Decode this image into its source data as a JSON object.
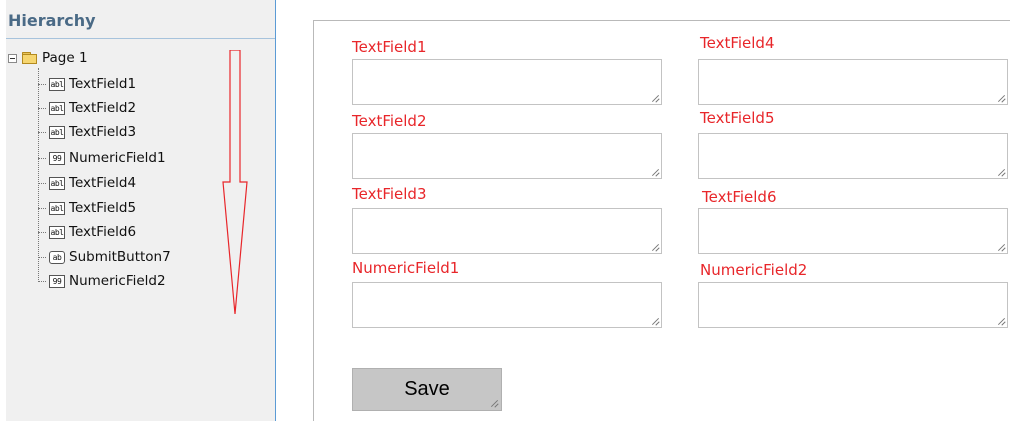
{
  "hierarchy": {
    "title": "Hierarchy",
    "root": {
      "label": "Page 1",
      "icon": "folder-icon"
    },
    "children": [
      {
        "type": "text",
        "icon_text": "abl",
        "label": "TextField1"
      },
      {
        "type": "text",
        "icon_text": "abl",
        "label": "TextField2"
      },
      {
        "type": "text",
        "icon_text": "abl",
        "label": "TextField3"
      },
      {
        "type": "numeric",
        "icon_text": "99",
        "label": "NumericField1"
      },
      {
        "type": "text",
        "icon_text": "abl",
        "label": "TextField4"
      },
      {
        "type": "text",
        "icon_text": "abl",
        "label": "TextField5"
      },
      {
        "type": "text",
        "icon_text": "abl",
        "label": "TextField6"
      },
      {
        "type": "button",
        "icon_text": "ab",
        "label": "SubmitButton7"
      },
      {
        "type": "numeric",
        "icon_text": "99",
        "label": "NumericField2"
      }
    ]
  },
  "form": {
    "fields": [
      {
        "label": "TextField1",
        "value": ""
      },
      {
        "label": "TextField4",
        "value": ""
      },
      {
        "label": "TextField2",
        "value": ""
      },
      {
        "label": "TextField5",
        "value": ""
      },
      {
        "label": "TextField3",
        "value": ""
      },
      {
        "label": "TextField6",
        "value": ""
      },
      {
        "label": "NumericField1",
        "value": ""
      },
      {
        "label": "NumericField2",
        "value": ""
      }
    ],
    "save_label": "Save"
  },
  "colors": {
    "label_red": "#e8262a",
    "panel_bg": "#f0f0f0",
    "panel_title": "#4a6a86",
    "arrow_red": "#e8262a",
    "button_gray": "#c6c6c6"
  }
}
